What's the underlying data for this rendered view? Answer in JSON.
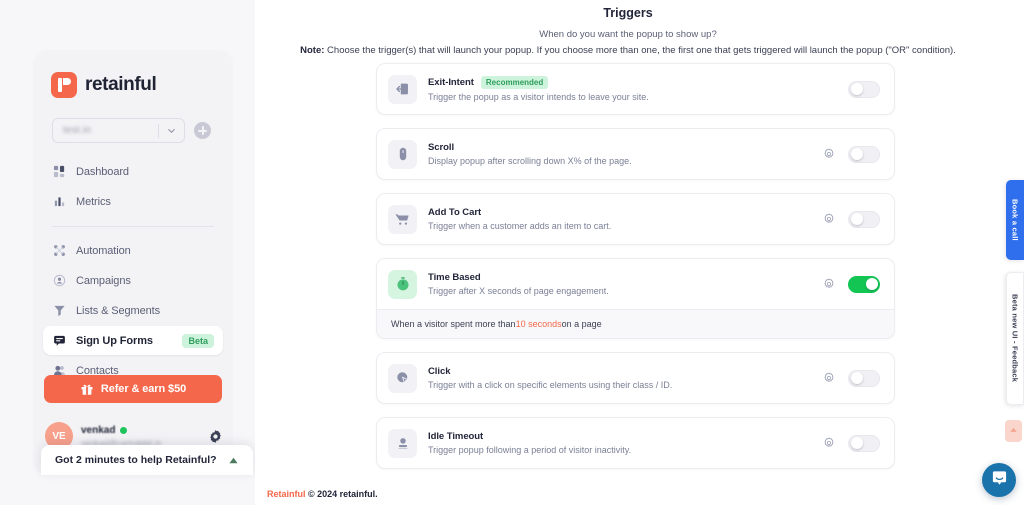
{
  "sidebar": {
    "brand": "retainful",
    "store_select": {
      "value": "test.in",
      "chevron_icon": "chevron-down-icon"
    },
    "add_store_label": "+",
    "nav_primary": [
      {
        "label": "Dashboard",
        "icon": "dashboard-icon"
      },
      {
        "label": "Metrics",
        "icon": "bar-chart-icon"
      }
    ],
    "nav_secondary": [
      {
        "label": "Automation",
        "icon": "automation-icon",
        "badge": ""
      },
      {
        "label": "Campaigns",
        "icon": "campaigns-icon",
        "badge": ""
      },
      {
        "label": "Lists & Segments",
        "icon": "lists-segments-icon",
        "badge": ""
      },
      {
        "label": "Sign Up Forms",
        "icon": "sign-up-forms-icon",
        "badge": "Beta",
        "active": true
      },
      {
        "label": "Contacts",
        "icon": "contacts-icon",
        "badge": ""
      }
    ],
    "refer": {
      "label": "Refer & earn $50",
      "icon": "gift-icon"
    },
    "user": {
      "initials": "VE",
      "name": "venkad",
      "email": "venkad@cartrabbit.in",
      "status": "online",
      "settings_icon": "gear-icon"
    },
    "survey": {
      "text": "Got 2 minutes to help Retainful?",
      "caret_icon": "caret-up-icon"
    }
  },
  "main": {
    "title": "Triggers",
    "subtitle": "When do you want the popup to show up?",
    "note_label": "Note:",
    "note_text": " Choose the trigger(s) that will launch your popup. If you choose more than one, the first one that gets triggered will launch the popup (\"OR\" condition).",
    "triggers": [
      {
        "name": "Exit-Intent",
        "badge": "Recommended",
        "description": "Trigger the popup as a visitor intends to leave your site.",
        "icon": "exit-intent-icon",
        "has_settings": false,
        "enabled": false,
        "detail": ""
      },
      {
        "name": "Scroll",
        "badge": "",
        "description": "Display popup after scrolling down X% of the page.",
        "icon": "mouse-icon",
        "has_settings": true,
        "enabled": false,
        "detail": ""
      },
      {
        "name": "Add To Cart",
        "badge": "",
        "description": "Trigger when a customer adds an item to cart.",
        "icon": "cart-icon",
        "has_settings": true,
        "enabled": false,
        "detail": ""
      },
      {
        "name": "Time Based",
        "badge": "",
        "description": "Trigger after X seconds of page engagement.",
        "icon": "stopwatch-icon",
        "has_settings": true,
        "enabled": true,
        "detail_prefix": "When a visitor spent more than ",
        "detail_value": "10 seconds",
        "detail_suffix": " on a page"
      },
      {
        "name": "Click",
        "badge": "",
        "description": "Trigger with a click on specific elements using their class / ID.",
        "icon": "click-cursor-icon",
        "has_settings": true,
        "enabled": false,
        "detail": ""
      },
      {
        "name": "Idle Timeout",
        "badge": "",
        "description": "Trigger popup following a period of visitor inactivity.",
        "icon": "idle-user-icon",
        "has_settings": true,
        "enabled": false,
        "detail": ""
      }
    ],
    "footer_brand": "Retainful",
    "footer_text": " © 2024 retainful."
  },
  "right_rail": {
    "book_a_call": "Book a call",
    "feedback": "Beta new UI - Feedback",
    "scroll_top_icon": "arrow-up-icon",
    "chat_icon": "intercom-chat-icon"
  },
  "colors": {
    "accent": "#f4674a",
    "toggle_on": "#13c654",
    "badge_green_bg": "#cdf3dc",
    "badge_green_text": "#2e9e5b",
    "book_call_blue": "#2f6fed",
    "intercom_blue": "#1a73ab"
  }
}
